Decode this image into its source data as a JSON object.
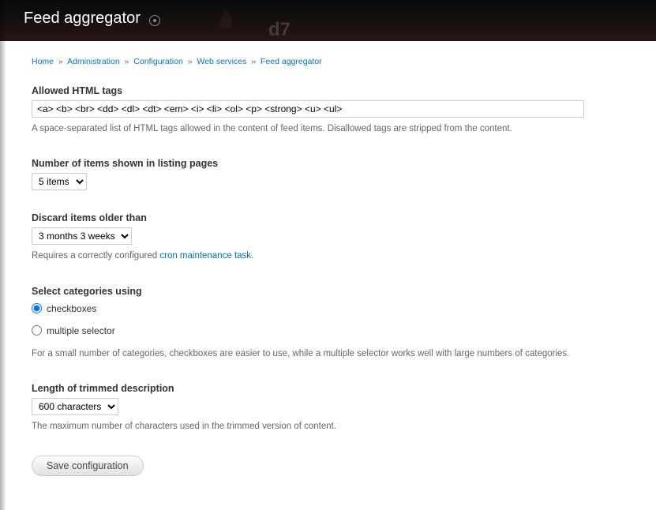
{
  "header": {
    "title": "Feed aggregator",
    "watermark": "d7"
  },
  "breadcrumb": {
    "items": [
      {
        "label": "Home"
      },
      {
        "label": "Administration"
      },
      {
        "label": "Configuration"
      },
      {
        "label": "Web services"
      },
      {
        "label": "Feed aggregator"
      }
    ],
    "separator": "»"
  },
  "form": {
    "allowed_tags": {
      "label": "Allowed HTML tags",
      "value": "<a> <b> <br> <dd> <dl> <dt> <em> <i> <li> <ol> <p> <strong> <u> <ul>",
      "description": "A space-separated list of HTML tags allowed in the content of feed items. Disallowed tags are stripped from the content."
    },
    "num_items": {
      "label": "Number of items shown in listing pages",
      "value": "5 items"
    },
    "discard": {
      "label": "Discard items older than",
      "value": "3 months 3 weeks",
      "description_prefix": "Requires a correctly configured ",
      "description_link": "cron maintenance task",
      "description_suffix": "."
    },
    "categories": {
      "label": "Select categories using",
      "opt1": "checkboxes",
      "opt2": "multiple selector",
      "description": "For a small number of categories, checkboxes are easier to use, while a multiple selector works well with large numbers of categories."
    },
    "trimmed": {
      "label": "Length of trimmed description",
      "value": "600 characters",
      "description": "The maximum number of characters used in the trimmed version of content."
    },
    "submit": "Save configuration"
  }
}
